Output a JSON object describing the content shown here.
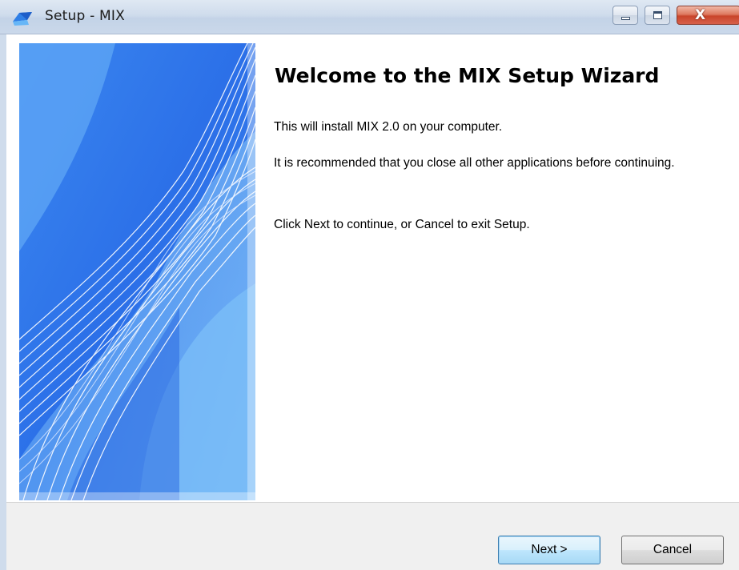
{
  "window": {
    "title": "Setup - MIX",
    "icon": "setup-app-icon",
    "controls": {
      "minimize_icon": "minimize-icon",
      "maximize_icon": "maximize-icon",
      "close_label": "X"
    }
  },
  "wizard": {
    "heading": "Welcome to the MIX Setup Wizard",
    "paragraphs": [
      "This will install MIX 2.0 on your computer.",
      "It is recommended that you close all other applications before continuing.",
      "Click Next to continue, or Cancel to exit Setup."
    ],
    "side_image": "wizard-wave-banner"
  },
  "footer": {
    "next_label": "Next >",
    "cancel_label": "Cancel"
  },
  "colors": {
    "banner_blue": "#3d8bf0",
    "banner_dark": "#1f5fe0",
    "close_red": "#c9452b",
    "default_button_border": "#3c7fb1"
  }
}
